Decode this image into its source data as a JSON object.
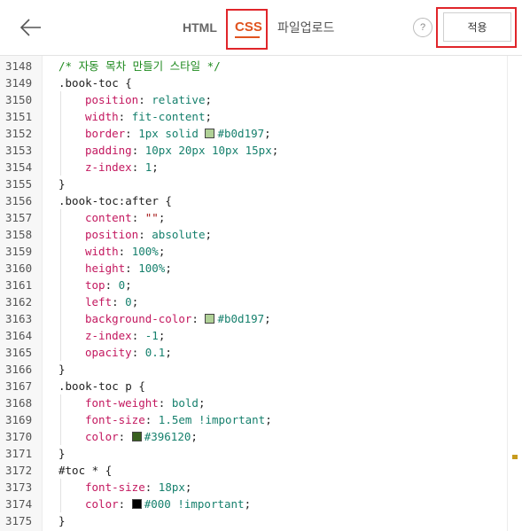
{
  "toolbar": {
    "tabs": [
      {
        "label": "HTML",
        "active": false
      },
      {
        "label": "CSS",
        "active": true
      },
      {
        "label": "파일업로드",
        "active": false
      }
    ],
    "help_label": "?",
    "apply_label": "적용",
    "accent_color": "#e0531f",
    "highlight_color": "#e0252a"
  },
  "editor": {
    "lines": [
      {
        "n": "3148",
        "indent": false,
        "tokens": [
          {
            "t": "comment",
            "v": "/* 자동 목차 만들기 스타일 */"
          }
        ]
      },
      {
        "n": "3149",
        "indent": false,
        "tokens": [
          {
            "t": "sel",
            "v": ".book-toc "
          },
          {
            "t": "punc",
            "v": "{"
          }
        ]
      },
      {
        "n": "3150",
        "indent": true,
        "tokens": [
          {
            "t": "prop",
            "v": "position"
          },
          {
            "t": "punc",
            "v": ": "
          },
          {
            "t": "val",
            "v": "relative"
          },
          {
            "t": "punc",
            "v": ";"
          }
        ]
      },
      {
        "n": "3151",
        "indent": true,
        "tokens": [
          {
            "t": "prop",
            "v": "width"
          },
          {
            "t": "punc",
            "v": ": "
          },
          {
            "t": "val",
            "v": "fit-content"
          },
          {
            "t": "punc",
            "v": ";"
          }
        ]
      },
      {
        "n": "3152",
        "indent": true,
        "tokens": [
          {
            "t": "prop",
            "v": "border"
          },
          {
            "t": "punc",
            "v": ": "
          },
          {
            "t": "val",
            "v": "1px solid "
          },
          {
            "t": "swatch",
            "v": "#b0d197"
          },
          {
            "t": "val",
            "v": "#b0d197"
          },
          {
            "t": "punc",
            "v": ";"
          }
        ]
      },
      {
        "n": "3153",
        "indent": true,
        "tokens": [
          {
            "t": "prop",
            "v": "padding"
          },
          {
            "t": "punc",
            "v": ": "
          },
          {
            "t": "val",
            "v": "10px 20px 10px 15px"
          },
          {
            "t": "punc",
            "v": ";"
          }
        ]
      },
      {
        "n": "3154",
        "indent": true,
        "tokens": [
          {
            "t": "prop",
            "v": "z-index"
          },
          {
            "t": "punc",
            "v": ": "
          },
          {
            "t": "val",
            "v": "1"
          },
          {
            "t": "punc",
            "v": ";"
          }
        ]
      },
      {
        "n": "3155",
        "indent": false,
        "tokens": [
          {
            "t": "punc",
            "v": "}"
          }
        ]
      },
      {
        "n": "3156",
        "indent": false,
        "tokens": [
          {
            "t": "sel",
            "v": ".book-toc:after "
          },
          {
            "t": "punc",
            "v": "{"
          }
        ]
      },
      {
        "n": "3157",
        "indent": true,
        "tokens": [
          {
            "t": "prop",
            "v": "content"
          },
          {
            "t": "punc",
            "v": ": "
          },
          {
            "t": "str",
            "v": "\"\""
          },
          {
            "t": "punc",
            "v": ";"
          }
        ]
      },
      {
        "n": "3158",
        "indent": true,
        "tokens": [
          {
            "t": "prop",
            "v": "position"
          },
          {
            "t": "punc",
            "v": ": "
          },
          {
            "t": "val",
            "v": "absolute"
          },
          {
            "t": "punc",
            "v": ";"
          }
        ]
      },
      {
        "n": "3159",
        "indent": true,
        "tokens": [
          {
            "t": "prop",
            "v": "width"
          },
          {
            "t": "punc",
            "v": ": "
          },
          {
            "t": "val",
            "v": "100%"
          },
          {
            "t": "punc",
            "v": ";"
          }
        ]
      },
      {
        "n": "3160",
        "indent": true,
        "tokens": [
          {
            "t": "prop",
            "v": "height"
          },
          {
            "t": "punc",
            "v": ": "
          },
          {
            "t": "val",
            "v": "100%"
          },
          {
            "t": "punc",
            "v": ";"
          }
        ]
      },
      {
        "n": "3161",
        "indent": true,
        "tokens": [
          {
            "t": "prop",
            "v": "top"
          },
          {
            "t": "punc",
            "v": ": "
          },
          {
            "t": "val",
            "v": "0"
          },
          {
            "t": "punc",
            "v": ";"
          }
        ]
      },
      {
        "n": "3162",
        "indent": true,
        "tokens": [
          {
            "t": "prop",
            "v": "left"
          },
          {
            "t": "punc",
            "v": ": "
          },
          {
            "t": "val",
            "v": "0"
          },
          {
            "t": "punc",
            "v": ";"
          }
        ]
      },
      {
        "n": "3163",
        "indent": true,
        "tokens": [
          {
            "t": "prop",
            "v": "background-color"
          },
          {
            "t": "punc",
            "v": ": "
          },
          {
            "t": "swatch",
            "v": "#b0d197"
          },
          {
            "t": "val",
            "v": "#b0d197"
          },
          {
            "t": "punc",
            "v": ";"
          }
        ]
      },
      {
        "n": "3164",
        "indent": true,
        "tokens": [
          {
            "t": "prop",
            "v": "z-index"
          },
          {
            "t": "punc",
            "v": ": "
          },
          {
            "t": "val",
            "v": "-1"
          },
          {
            "t": "punc",
            "v": ";"
          }
        ]
      },
      {
        "n": "3165",
        "indent": true,
        "tokens": [
          {
            "t": "prop",
            "v": "opacity"
          },
          {
            "t": "punc",
            "v": ": "
          },
          {
            "t": "val",
            "v": "0.1"
          },
          {
            "t": "punc",
            "v": ";"
          }
        ]
      },
      {
        "n": "3166",
        "indent": false,
        "tokens": [
          {
            "t": "punc",
            "v": "}"
          }
        ]
      },
      {
        "n": "3167",
        "indent": false,
        "tokens": [
          {
            "t": "sel",
            "v": ".book-toc p "
          },
          {
            "t": "punc",
            "v": "{"
          }
        ]
      },
      {
        "n": "3168",
        "indent": true,
        "tokens": [
          {
            "t": "prop",
            "v": "font-weight"
          },
          {
            "t": "punc",
            "v": ": "
          },
          {
            "t": "val",
            "v": "bold"
          },
          {
            "t": "punc",
            "v": ";"
          }
        ]
      },
      {
        "n": "3169",
        "indent": true,
        "tokens": [
          {
            "t": "prop",
            "v": "font-size"
          },
          {
            "t": "punc",
            "v": ": "
          },
          {
            "t": "val",
            "v": "1.5em !important"
          },
          {
            "t": "punc",
            "v": ";"
          }
        ]
      },
      {
        "n": "3170",
        "indent": true,
        "tokens": [
          {
            "t": "prop",
            "v": "color"
          },
          {
            "t": "punc",
            "v": ": "
          },
          {
            "t": "swatch",
            "v": "#396120"
          },
          {
            "t": "val",
            "v": "#396120"
          },
          {
            "t": "punc",
            "v": ";"
          }
        ]
      },
      {
        "n": "3171",
        "indent": false,
        "tokens": [
          {
            "t": "punc",
            "v": "}"
          }
        ]
      },
      {
        "n": "3172",
        "indent": false,
        "tokens": [
          {
            "t": "sel",
            "v": "#toc * "
          },
          {
            "t": "punc",
            "v": "{"
          }
        ]
      },
      {
        "n": "3173",
        "indent": true,
        "tokens": [
          {
            "t": "prop",
            "v": "font-size"
          },
          {
            "t": "punc",
            "v": ": "
          },
          {
            "t": "val",
            "v": "18px"
          },
          {
            "t": "punc",
            "v": ";"
          }
        ]
      },
      {
        "n": "3174",
        "indent": true,
        "tokens": [
          {
            "t": "prop",
            "v": "color"
          },
          {
            "t": "punc",
            "v": ": "
          },
          {
            "t": "swatch",
            "v": "#000000"
          },
          {
            "t": "val",
            "v": "#000 !important"
          },
          {
            "t": "punc",
            "v": ";"
          }
        ]
      },
      {
        "n": "3175",
        "indent": false,
        "tokens": [
          {
            "t": "punc",
            "v": "}"
          }
        ]
      }
    ],
    "scroll_marker_color": "#c79b1e"
  }
}
